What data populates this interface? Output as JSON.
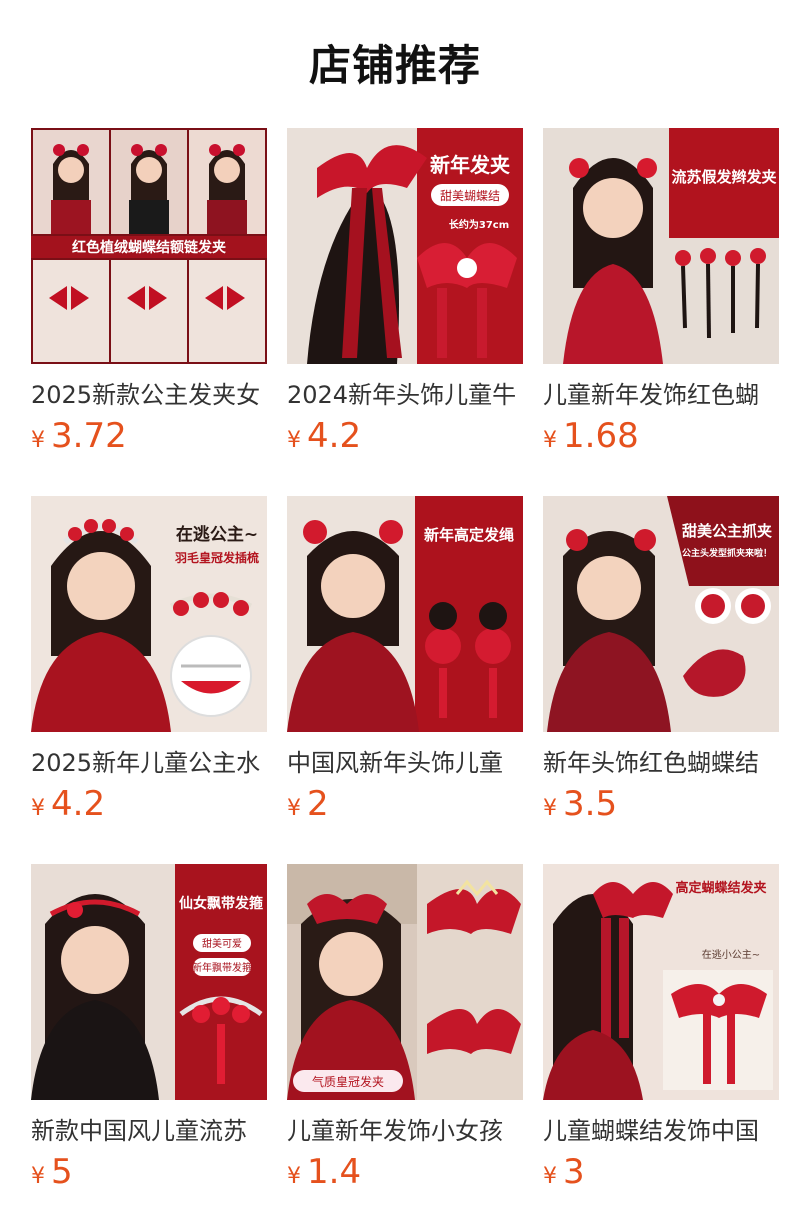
{
  "section": {
    "title": "店铺推荐"
  },
  "colors": {
    "price": "#e5511d",
    "text": "#333333",
    "accent_red": "#b01a24"
  },
  "products": [
    {
      "name": "2025新款公主发夹女",
      "currency": "¥",
      "price": "3.72",
      "image_text": [
        "红色植绒蝴蝶结额链发夹"
      ]
    },
    {
      "name": "2024新年头饰儿童牛",
      "currency": "¥",
      "price": "4.2",
      "image_text": [
        "新年发夹",
        "甜美蝴蝶结",
        "长约为37cm"
      ]
    },
    {
      "name": "儿童新年发饰红色蝴",
      "currency": "¥",
      "price": "1.68",
      "image_text": [
        "流苏假发辫发夹"
      ]
    },
    {
      "name": "2025新年儿童公主水",
      "currency": "¥",
      "price": "4.2",
      "image_text": [
        "在逃公主~",
        "羽毛皇冠发插梳"
      ]
    },
    {
      "name": "中国风新年头饰儿童",
      "currency": "¥",
      "price": "2",
      "image_text": [
        "新年高定发绳"
      ]
    },
    {
      "name": "新年头饰红色蝴蝶结",
      "currency": "¥",
      "price": "3.5",
      "image_text": [
        "甜美公主抓夹",
        "公主头发型抓夹来啦！"
      ]
    },
    {
      "name": "新款中国风儿童流苏",
      "currency": "¥",
      "price": "5",
      "image_text": [
        "仙女飘带发箍",
        "甜美可爱",
        "新年飘带发箍"
      ]
    },
    {
      "name": "儿童新年发饰小女孩",
      "currency": "¥",
      "price": "1.4",
      "image_text": [
        "气质皇冠发夹"
      ]
    },
    {
      "name": "儿童蝴蝶结发饰中国",
      "currency": "¥",
      "price": "3",
      "image_text": [
        "高定蝴蝶结发夹",
        "在逃小公主~"
      ]
    }
  ]
}
